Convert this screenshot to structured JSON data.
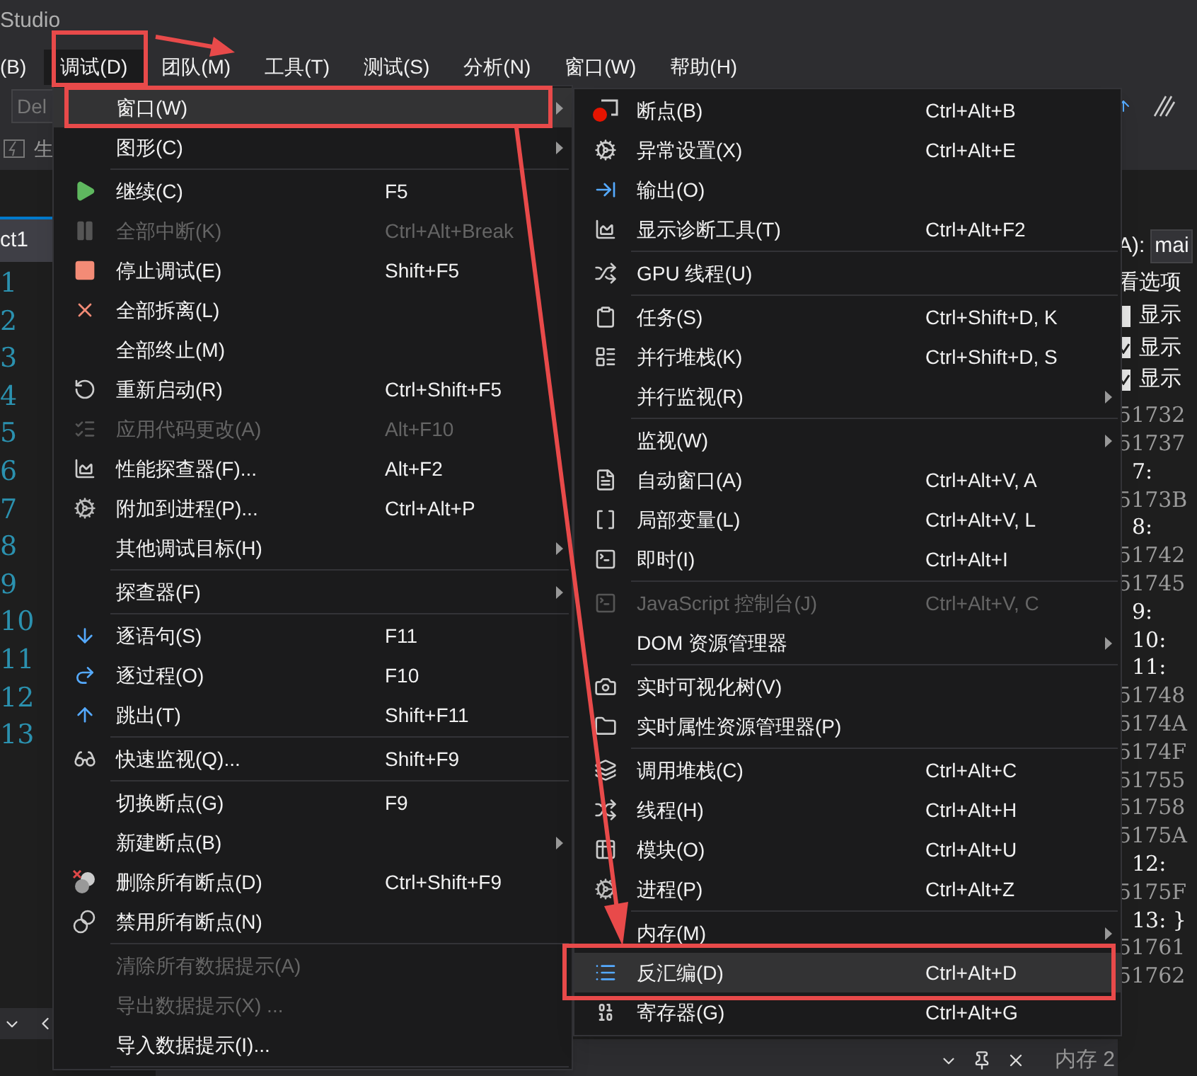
{
  "window": {
    "title": "Studio"
  },
  "menu_bar": [
    {
      "label": "(B)",
      "selected": false
    },
    {
      "label": "调试(D)",
      "selected": true
    },
    {
      "label": "团队(M)",
      "selected": false
    },
    {
      "label": "工具(T)",
      "selected": false
    },
    {
      "label": "测试(S)",
      "selected": false
    },
    {
      "label": "分析(N)",
      "selected": false
    },
    {
      "label": "窗口(W)",
      "selected": false
    },
    {
      "label": "帮助(H)",
      "selected": false
    }
  ],
  "toolbar": {
    "field_value": "Del",
    "label": "生"
  },
  "editor": {
    "tab": "ct1",
    "line_numbers": [
      "1",
      "2",
      "3",
      "4",
      "5",
      "6",
      "7",
      "8",
      "9",
      "10",
      "11",
      "12",
      "13"
    ]
  },
  "debug_menu": [
    {
      "kind": "item",
      "label": "窗口(W)",
      "submenu": true,
      "disabled": false,
      "selected": true
    },
    {
      "kind": "item",
      "label": "图形(C)",
      "submenu": true,
      "disabled": false,
      "selected": false
    },
    {
      "kind": "separator"
    },
    {
      "kind": "item",
      "label": "继续(C)",
      "shortcut": "F5",
      "submenu": false,
      "disabled": false,
      "selected": false
    },
    {
      "kind": "item",
      "label": "全部中断(K)",
      "shortcut": "Ctrl+Alt+Break",
      "submenu": false,
      "disabled": true,
      "selected": false
    },
    {
      "kind": "item",
      "label": "停止调试(E)",
      "shortcut": "Shift+F5",
      "submenu": false,
      "disabled": false,
      "selected": false
    },
    {
      "kind": "item",
      "label": "全部拆离(L)",
      "submenu": false,
      "disabled": false,
      "selected": false
    },
    {
      "kind": "item",
      "label": "全部终止(M)",
      "submenu": false,
      "disabled": false,
      "selected": false
    },
    {
      "kind": "item",
      "label": "重新启动(R)",
      "shortcut": "Ctrl+Shift+F5",
      "submenu": false,
      "disabled": false,
      "selected": false
    },
    {
      "kind": "item",
      "label": "应用代码更改(A)",
      "shortcut": "Alt+F10",
      "submenu": false,
      "disabled": true,
      "selected": false
    },
    {
      "kind": "item",
      "label": "性能探查器(F)...",
      "shortcut": "Alt+F2",
      "submenu": false,
      "disabled": false,
      "selected": false
    },
    {
      "kind": "item",
      "label": "附加到进程(P)...",
      "shortcut": "Ctrl+Alt+P",
      "submenu": false,
      "disabled": false,
      "selected": false
    },
    {
      "kind": "item",
      "label": "其他调试目标(H)",
      "submenu": true,
      "disabled": false,
      "selected": false
    },
    {
      "kind": "separator"
    },
    {
      "kind": "item",
      "label": "探查器(F)",
      "submenu": true,
      "disabled": false,
      "selected": false
    },
    {
      "kind": "separator"
    },
    {
      "kind": "item",
      "label": "逐语句(S)",
      "shortcut": "F11",
      "submenu": false,
      "disabled": false,
      "selected": false
    },
    {
      "kind": "item",
      "label": "逐过程(O)",
      "shortcut": "F10",
      "submenu": false,
      "disabled": false,
      "selected": false
    },
    {
      "kind": "item",
      "label": "跳出(T)",
      "shortcut": "Shift+F11",
      "submenu": false,
      "disabled": false,
      "selected": false
    },
    {
      "kind": "separator"
    },
    {
      "kind": "item",
      "label": "快速监视(Q)...",
      "shortcut": "Shift+F9",
      "submenu": false,
      "disabled": false,
      "selected": false
    },
    {
      "kind": "separator"
    },
    {
      "kind": "item",
      "label": "切换断点(G)",
      "shortcut": "F9",
      "submenu": false,
      "disabled": false,
      "selected": false
    },
    {
      "kind": "item",
      "label": "新建断点(B)",
      "submenu": true,
      "disabled": false,
      "selected": false
    },
    {
      "kind": "item",
      "label": "删除所有断点(D)",
      "shortcut": "Ctrl+Shift+F9",
      "submenu": false,
      "disabled": false,
      "selected": false
    },
    {
      "kind": "item",
      "label": "禁用所有断点(N)",
      "submenu": false,
      "disabled": false,
      "selected": false
    },
    {
      "kind": "separator"
    },
    {
      "kind": "item",
      "label": "清除所有数据提示(A)",
      "submenu": false,
      "disabled": true,
      "selected": false
    },
    {
      "kind": "item",
      "label": "导出数据提示(X) ...",
      "submenu": false,
      "disabled": true,
      "selected": false
    },
    {
      "kind": "item",
      "label": "导入数据提示(I)...",
      "submenu": false,
      "disabled": false,
      "selected": false
    },
    {
      "kind": "separator"
    }
  ],
  "windows_submenu": [
    {
      "kind": "item",
      "label": "断点(B)",
      "shortcut": "Ctrl+Alt+B",
      "submenu": false,
      "disabled": false,
      "selected": false
    },
    {
      "kind": "item",
      "label": "异常设置(X)",
      "shortcut": "Ctrl+Alt+E",
      "submenu": false,
      "disabled": false,
      "selected": false
    },
    {
      "kind": "item",
      "label": "输出(O)",
      "submenu": false,
      "disabled": false,
      "selected": false
    },
    {
      "kind": "item",
      "label": "显示诊断工具(T)",
      "shortcut": "Ctrl+Alt+F2",
      "submenu": false,
      "disabled": false,
      "selected": false
    },
    {
      "kind": "separator"
    },
    {
      "kind": "item",
      "label": "GPU 线程(U)",
      "submenu": false,
      "disabled": false,
      "selected": false
    },
    {
      "kind": "separator"
    },
    {
      "kind": "item",
      "label": "任务(S)",
      "shortcut": "Ctrl+Shift+D, K",
      "submenu": false,
      "disabled": false,
      "selected": false
    },
    {
      "kind": "item",
      "label": "并行堆栈(K)",
      "shortcut": "Ctrl+Shift+D, S",
      "submenu": false,
      "disabled": false,
      "selected": false
    },
    {
      "kind": "item",
      "label": "并行监视(R)",
      "submenu": true,
      "disabled": false,
      "selected": false
    },
    {
      "kind": "separator"
    },
    {
      "kind": "item",
      "label": "监视(W)",
      "submenu": true,
      "disabled": false,
      "selected": false
    },
    {
      "kind": "item",
      "label": "自动窗口(A)",
      "shortcut": "Ctrl+Alt+V, A",
      "submenu": false,
      "disabled": false,
      "selected": false
    },
    {
      "kind": "item",
      "label": "局部变量(L)",
      "shortcut": "Ctrl+Alt+V, L",
      "submenu": false,
      "disabled": false,
      "selected": false
    },
    {
      "kind": "item",
      "label": "即时(I)",
      "shortcut": "Ctrl+Alt+I",
      "submenu": false,
      "disabled": false,
      "selected": false
    },
    {
      "kind": "separator"
    },
    {
      "kind": "item",
      "label": "JavaScript 控制台(J)",
      "shortcut": "Ctrl+Alt+V, C",
      "submenu": false,
      "disabled": true,
      "selected": false
    },
    {
      "kind": "item",
      "label": "DOM 资源管理器",
      "submenu": true,
      "disabled": false,
      "selected": false
    },
    {
      "kind": "separator"
    },
    {
      "kind": "item",
      "label": "实时可视化树(V)",
      "submenu": false,
      "disabled": false,
      "selected": false
    },
    {
      "kind": "item",
      "label": "实时属性资源管理器(P)",
      "submenu": false,
      "disabled": false,
      "selected": false
    },
    {
      "kind": "separator"
    },
    {
      "kind": "item",
      "label": "调用堆栈(C)",
      "shortcut": "Ctrl+Alt+C",
      "submenu": false,
      "disabled": false,
      "selected": false
    },
    {
      "kind": "item",
      "label": "线程(H)",
      "shortcut": "Ctrl+Alt+H",
      "submenu": false,
      "disabled": false,
      "selected": false
    },
    {
      "kind": "item",
      "label": "模块(O)",
      "shortcut": "Ctrl+Alt+U",
      "submenu": false,
      "disabled": false,
      "selected": false
    },
    {
      "kind": "item",
      "label": "进程(P)",
      "shortcut": "Ctrl+Alt+Z",
      "submenu": false,
      "disabled": false,
      "selected": false
    },
    {
      "kind": "separator"
    },
    {
      "kind": "item",
      "label": "内存(M)",
      "submenu": true,
      "disabled": false,
      "selected": false
    },
    {
      "kind": "item",
      "label": "反汇编(D)",
      "shortcut": "Ctrl+Alt+D",
      "submenu": false,
      "disabled": false,
      "selected": true
    },
    {
      "kind": "item",
      "label": "寄存器(G)",
      "shortcut": "Ctrl+Alt+G",
      "submenu": false,
      "disabled": false,
      "selected": false
    }
  ],
  "disassembly": {
    "address_label": "A):",
    "address_value": "mai",
    "options_title": "看选项",
    "options": [
      {
        "label": "显示",
        "checked": false
      },
      {
        "label": "显示",
        "checked": true
      },
      {
        "label": "显示",
        "checked": true
      }
    ],
    "lines": [
      {
        "kind": "address",
        "text": "51732"
      },
      {
        "kind": "address",
        "text": "51737"
      },
      {
        "kind": "source",
        "text": "7:"
      },
      {
        "kind": "address",
        "text": "5173B"
      },
      {
        "kind": "source",
        "text": "8:"
      },
      {
        "kind": "address",
        "text": "51742"
      },
      {
        "kind": "address",
        "text": "51745"
      },
      {
        "kind": "source",
        "text": "9:"
      },
      {
        "kind": "source",
        "text": "10:"
      },
      {
        "kind": "source",
        "text": "11:"
      },
      {
        "kind": "address",
        "text": "51748"
      },
      {
        "kind": "address",
        "text": "5174A"
      },
      {
        "kind": "address",
        "text": "5174F"
      },
      {
        "kind": "address",
        "text": "51755"
      },
      {
        "kind": "address",
        "text": "51758"
      },
      {
        "kind": "address",
        "text": "5175A"
      },
      {
        "kind": "source",
        "text": "12:"
      },
      {
        "kind": "address",
        "text": "5175F"
      },
      {
        "kind": "source",
        "text": "13: }"
      },
      {
        "kind": "address",
        "text": "51761"
      },
      {
        "kind": "address",
        "text": "51762"
      }
    ]
  },
  "bottom_tab": "内存 2"
}
